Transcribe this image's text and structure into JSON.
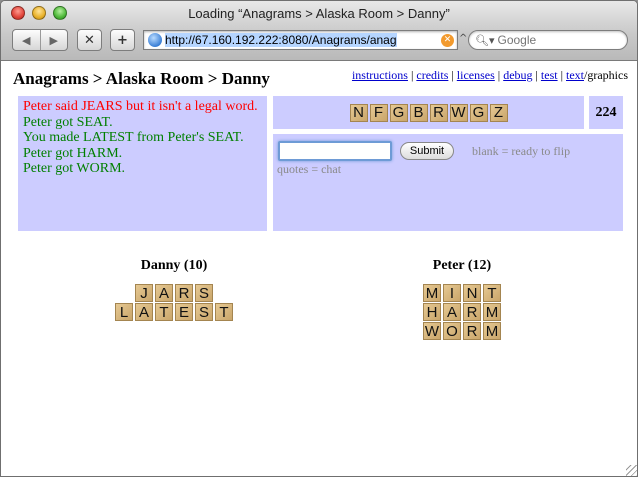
{
  "window": {
    "title": "Loading “Anagrams > Alaska Room > Danny”",
    "url": "http://67.160.192.222:8080/Anagrams/anag",
    "search_placeholder": "Google"
  },
  "page": {
    "title": "Anagrams > Alaska Room > Danny",
    "links": [
      "instructions",
      "credits",
      "licenses",
      "debug",
      "test",
      "text"
    ],
    "links_tail": "/graphics"
  },
  "messages": [
    {
      "text": "Peter said JEARS but it isn't a legal word.",
      "type": "error",
      "color": "#ff0000"
    },
    {
      "text": "Peter got SEAT.",
      "type": "ok",
      "color": "#007f00"
    },
    {
      "text": "You made LATEST from Peter's SEAT.",
      "type": "ok",
      "color": "#007f00"
    },
    {
      "text": "Peter got HARM.",
      "type": "ok",
      "color": "#007f00"
    },
    {
      "text": "Peter got WORM.",
      "type": "ok",
      "color": "#007f00"
    }
  ],
  "pool": {
    "tiles": [
      "N",
      "F",
      "G",
      "B",
      "R",
      "W",
      "G",
      "Z"
    ]
  },
  "tiles_remaining": "224",
  "input": {
    "value": "",
    "submit_label": "Submit",
    "hint_blank": "blank = ready to flip",
    "hint_quotes": "quotes = chat"
  },
  "players": [
    {
      "name": "Danny (10)",
      "words": [
        "JARS",
        "LATEST"
      ]
    },
    {
      "name": "Peter (12)",
      "words": [
        "MINT",
        "HARM",
        "WORM"
      ]
    }
  ],
  "colors": {
    "panel": "#ccccff",
    "tile": "#d9b77f",
    "link": "#0000cc"
  }
}
